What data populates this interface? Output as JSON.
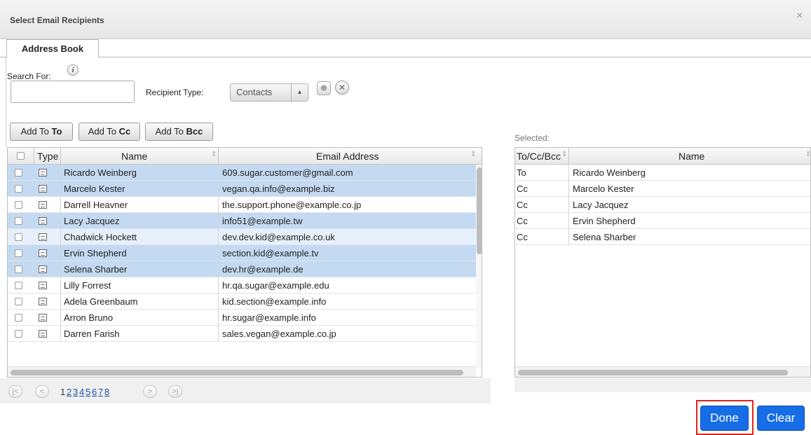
{
  "dialog": {
    "title": "Select Email Recipients",
    "close_glyph": "×"
  },
  "tabs": [
    {
      "label": "Address Book"
    }
  ],
  "search": {
    "label": "Search For:",
    "info_glyph": "i",
    "value": ""
  },
  "recipient_type": {
    "label": "Recipient Type:",
    "value": "Contacts"
  },
  "add_buttons": [
    {
      "prefix": "Add To ",
      "suffix": "To"
    },
    {
      "prefix": "Add To ",
      "suffix": "Cc"
    },
    {
      "prefix": "Add To ",
      "suffix": "Bcc"
    }
  ],
  "grid": {
    "headers": {
      "type": "Type",
      "name": "Name",
      "email": "Email Address"
    },
    "rows": [
      {
        "name": "Ricardo Weinberg",
        "email": "609.sugar.customer@gmail.com",
        "state": "selected"
      },
      {
        "name": "Marcelo Kester",
        "email": "vegan.qa.info@example.biz",
        "state": "selected"
      },
      {
        "name": "Darrell Heavner",
        "email": "the.support.phone@example.co.jp",
        "state": "normal"
      },
      {
        "name": "Lacy Jacquez",
        "email": "info51@example.tw",
        "state": "selected"
      },
      {
        "name": "Chadwick Hockett",
        "email": "dev.dev.kid@example.co.uk",
        "state": "light"
      },
      {
        "name": "Ervin Shepherd",
        "email": "section.kid@example.tv",
        "state": "selected"
      },
      {
        "name": "Selena Sharber",
        "email": "dev.hr@example.de",
        "state": "selected"
      },
      {
        "name": "Lilly Forrest",
        "email": "hr.qa.sugar@example.edu",
        "state": "normal"
      },
      {
        "name": "Adela Greenbaum",
        "email": "kid.section@example.info",
        "state": "normal"
      },
      {
        "name": "Arron Bruno",
        "email": "hr.sugar@example.info",
        "state": "normal"
      },
      {
        "name": "Darren Farish",
        "email": "sales.vegan@example.co.jp",
        "state": "normal"
      }
    ]
  },
  "pagination": {
    "current": "1",
    "pages": [
      "2",
      "3",
      "4",
      "5",
      "6",
      "7",
      "8"
    ]
  },
  "selected": {
    "label": "Selected:",
    "headers": {
      "kind": "To/Cc/Bcc",
      "name": "Name"
    },
    "rows": [
      {
        "kind": "To",
        "name": "Ricardo Weinberg"
      },
      {
        "kind": "Cc",
        "name": "Marcelo Kester"
      },
      {
        "kind": "Cc",
        "name": "Lacy Jacquez"
      },
      {
        "kind": "Cc",
        "name": "Ervin Shepherd"
      },
      {
        "kind": "Cc",
        "name": "Selena Sharber"
      }
    ]
  },
  "footer": {
    "done_label": "Done",
    "clear_label": "Clear"
  },
  "colors": {
    "selected_row": "#c4daf2",
    "primary_button": "#176de5",
    "highlight_border": "#e2231a"
  }
}
